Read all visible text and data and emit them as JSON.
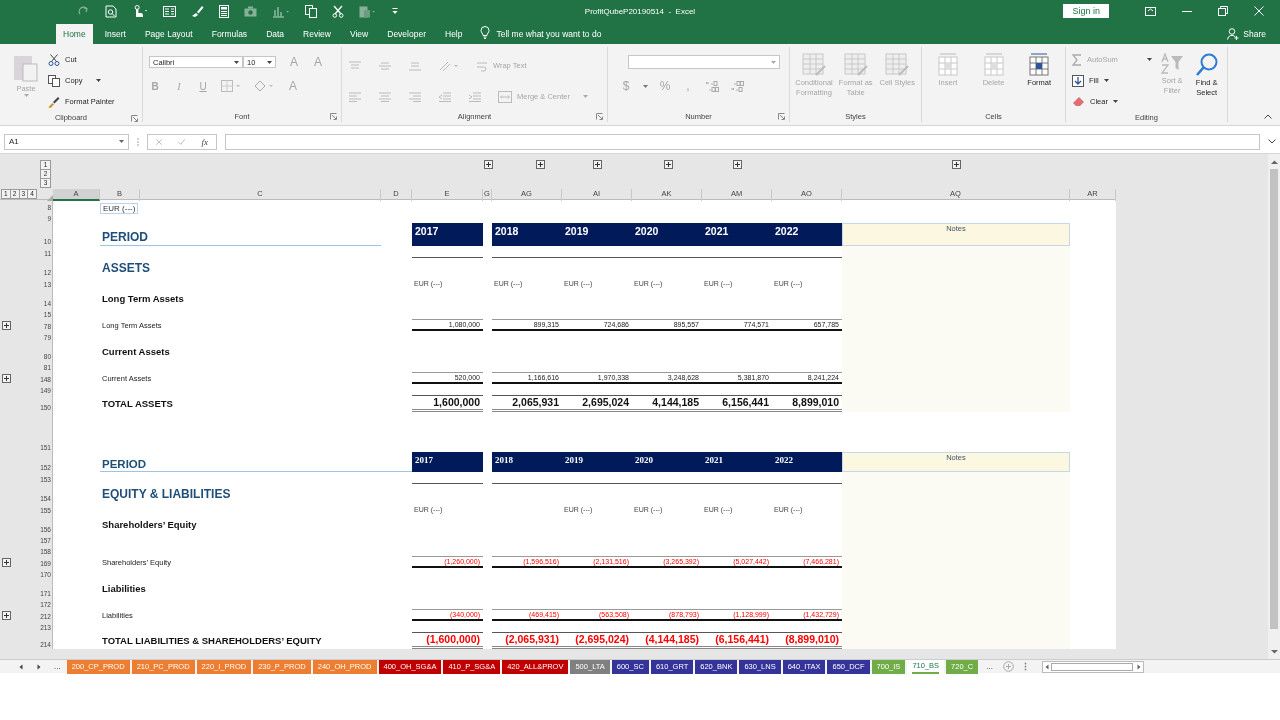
{
  "title_bar": {
    "title": "ProfitQubeP20190514  -  Excel",
    "sign_in": "Sign in"
  },
  "ribbon_tabs": [
    {
      "label": "Home",
      "selected": true
    },
    {
      "label": "Insert",
      "selected": false
    },
    {
      "label": "Page Layout",
      "selected": false
    },
    {
      "label": "Formulas",
      "selected": false
    },
    {
      "label": "Data",
      "selected": false
    },
    {
      "label": "Review",
      "selected": false
    },
    {
      "label": "View",
      "selected": false
    },
    {
      "label": "Developer",
      "selected": false
    },
    {
      "label": "Help",
      "selected": false
    }
  ],
  "tell_me": "Tell me what you want to do",
  "share": "Share",
  "ribbon": {
    "clipboard": {
      "label": "Clipboard",
      "paste": {
        "label": "Paste",
        "disabled": true
      },
      "cut": "Cut",
      "copy": "Copy",
      "format_painter": "Format Painter"
    },
    "font": {
      "label": "Font",
      "font_name": "Calibri",
      "font_size": "10",
      "grow": "A",
      "shrink": "A",
      "bold": "B",
      "italic": "I",
      "underline": "U",
      "font_color_button": "A"
    },
    "alignment": {
      "label": "Alignment",
      "wrap_text": {
        "label": "Wrap Text",
        "disabled": true
      },
      "merge": {
        "label": "Merge & Center",
        "disabled": true
      }
    },
    "number": {
      "label": "Number",
      "currency": "$",
      "percent": "%",
      "comma": ","
    },
    "styles": {
      "label": "Styles",
      "buttons": [
        {
          "label": "Conditional Formatting",
          "disabled": true
        },
        {
          "label": "Format as Table",
          "disabled": true
        },
        {
          "label": "Cell Styles",
          "disabled": true
        }
      ]
    },
    "cells": {
      "label": "Cells",
      "buttons": [
        {
          "label": "Insert",
          "disabled": true
        },
        {
          "label": "Delete",
          "disabled": true
        },
        {
          "label": "Format",
          "disabled": false
        }
      ]
    },
    "editing": {
      "label": "Editing",
      "autosum": {
        "label": "AutoSum",
        "disabled": true
      },
      "fill": {
        "label": "Fill",
        "disabled": false
      },
      "clear": {
        "label": "Clear",
        "disabled": false
      },
      "sort": {
        "label": "Sort & Filter",
        "disabled": true
      },
      "find": {
        "label": "Find & Select",
        "disabled": false
      }
    }
  },
  "formula_bar": {
    "name_box": "A1",
    "function_button": "fx"
  },
  "outline": {
    "column_levels": [
      "1",
      "2",
      "3"
    ],
    "row_levels": [
      "1",
      "2",
      "3",
      "4"
    ]
  },
  "columns": [
    {
      "label": "A",
      "selected": true
    },
    {
      "label": "B",
      "selected": false
    },
    {
      "label": "C",
      "selected": false
    },
    {
      "label": "D",
      "selected": false
    },
    {
      "label": "E",
      "selected": false
    },
    {
      "label": "G",
      "selected": false
    },
    {
      "label": "AG",
      "selected": false
    },
    {
      "label": "AI",
      "selected": false
    },
    {
      "label": "AK",
      "selected": false
    },
    {
      "label": "AM",
      "selected": false
    },
    {
      "label": "AO",
      "selected": false
    },
    {
      "label": "AQ",
      "selected": false
    },
    {
      "label": "AR",
      "selected": false
    }
  ],
  "rows": [
    {
      "number": "8",
      "kind": "unit_note",
      "label": "EUR (---)",
      "collapsed": false
    },
    {
      "number": "9",
      "kind": "blank",
      "collapsed": false
    },
    {
      "number": "10",
      "kind": "period",
      "compact": false,
      "label": "PERIOD",
      "first_year": "2017",
      "years": [
        "2018",
        "2019",
        "2020",
        "2021",
        "2022"
      ],
      "notes": "Notes",
      "collapsed": false
    },
    {
      "number": "11",
      "kind": "rule",
      "collapsed": false
    },
    {
      "number": "12",
      "kind": "heading",
      "label": "ASSETS",
      "collapsed": false
    },
    {
      "number": "13",
      "kind": "units",
      "first_unit": "EUR (---)",
      "first_column_empty": false,
      "units": [
        "EUR (---)",
        "EUR (---)",
        "EUR (---)",
        "EUR (---)",
        "EUR (---)"
      ],
      "collapsed": false
    },
    {
      "number": "14",
      "kind": "subheading",
      "label": "Long Term Assets",
      "collapsed": false
    },
    {
      "number": "15",
      "kind": "blank",
      "collapsed": false
    },
    {
      "number": "78",
      "kind": "line",
      "label": "Long Term Assets",
      "first_value": "1,080,000",
      "values": [
        "899,315",
        "724,686",
        "895,557",
        "774,571",
        "657,785"
      ],
      "negative": false,
      "collapsed": true
    },
    {
      "number": "79",
      "kind": "blank",
      "collapsed": false
    },
    {
      "number": "80",
      "kind": "subheading",
      "label": "Current Assets",
      "collapsed": false
    },
    {
      "number": "81",
      "kind": "blank",
      "collapsed": false
    },
    {
      "number": "148",
      "kind": "line",
      "label": "Current Assets",
      "first_value": "520,000",
      "values": [
        "1,166,616",
        "1,970,338",
        "3,248,628",
        "5,381,870",
        "8,241,224"
      ],
      "negative": false,
      "collapsed": true
    },
    {
      "number": "149",
      "kind": "blank",
      "collapsed": false
    },
    {
      "number": "150",
      "kind": "total",
      "label": "TOTAL ASSETS",
      "first_value": "1,600,000",
      "values": [
        "2,065,931",
        "2,695,024",
        "4,144,185",
        "6,156,441",
        "8,899,010"
      ],
      "negative": false,
      "collapsed": false
    },
    {
      "number": "151",
      "kind": "gap",
      "collapsed": false
    },
    {
      "number": "152",
      "kind": "period",
      "compact": true,
      "label": "PERIOD",
      "first_year": "2017",
      "years": [
        "2018",
        "2019",
        "2020",
        "2021",
        "2022"
      ],
      "notes": "Notes",
      "collapsed": false
    },
    {
      "number": "153",
      "kind": "rule",
      "collapsed": false
    },
    {
      "number": "154",
      "kind": "heading",
      "label": "EQUITY & LIABILITIES",
      "collapsed": false
    },
    {
      "number": "155",
      "kind": "units",
      "first_unit": "EUR (---)",
      "first_column_empty": true,
      "units": [
        "EUR (---)",
        "EUR (---)",
        "EUR (---)",
        "EUR (---)"
      ],
      "collapsed": false
    },
    {
      "number": "156",
      "kind": "subheading",
      "label": "Shareholders’ Equity",
      "collapsed": false
    },
    {
      "number": "157",
      "kind": "blank",
      "collapsed": false
    },
    {
      "number": "158",
      "kind": "blank",
      "collapsed": false
    },
    {
      "number": "169",
      "kind": "line",
      "label": "Shareholders’ Equity",
      "first_value": "(1,260,000)",
      "values": [
        "(1,596,516)",
        "(2,131,516)",
        "(3,265,392)",
        "(5,027,442)",
        "(7,466,281)"
      ],
      "negative": true,
      "collapsed": true
    },
    {
      "number": "170",
      "kind": "blank",
      "collapsed": false
    },
    {
      "number": "171",
      "kind": "subheading",
      "label": "Liabilities",
      "collapsed": false
    },
    {
      "number": "172",
      "kind": "blank",
      "collapsed": false
    },
    {
      "number": "212",
      "kind": "line",
      "label": "Liabilities",
      "first_value": "(340,000)",
      "values": [
        "(469,415)",
        "(563,508)",
        "(878,793)",
        "(1,128,999)",
        "(1,432,729)"
      ],
      "negative": true,
      "collapsed": true
    },
    {
      "number": "213",
      "kind": "blank",
      "collapsed": false
    },
    {
      "number": "214",
      "kind": "total",
      "label": "TOTAL LIABILITIES & SHAREHOLDERS’ EQUITY",
      "first_value": "(1,600,000)",
      "values": [
        "(2,065,931)",
        "(2,695,024)",
        "(4,144,185)",
        "(6,156,441)",
        "(8,899,010)"
      ],
      "negative": true,
      "collapsed": false
    }
  ],
  "sheet_nav": {
    "more_left": "...",
    "more_right": "..."
  },
  "sheet_tabs": [
    {
      "label": "200_CP_PROD",
      "color": "#ed7d31",
      "selected": false
    },
    {
      "label": "210_PC_PROD",
      "color": "#ed7d31",
      "selected": false
    },
    {
      "label": "220_I_PROD",
      "color": "#ed7d31",
      "selected": false
    },
    {
      "label": "230_P_PROD",
      "color": "#ed7d31",
      "selected": false
    },
    {
      "label": "240_OH_PROD",
      "color": "#ed7d31",
      "selected": false
    },
    {
      "label": "400_OH_SG&A",
      "color": "#c00000",
      "selected": false
    },
    {
      "label": "410_P_SG&A",
      "color": "#c00000",
      "selected": false
    },
    {
      "label": "420_ALL&PROV",
      "color": "#c00000",
      "selected": false
    },
    {
      "label": "500_LTA",
      "color": "#808080",
      "selected": false
    },
    {
      "label": "600_SC",
      "color": "#333399",
      "selected": false
    },
    {
      "label": "610_GRT",
      "color": "#333399",
      "selected": false
    },
    {
      "label": "620_BNK",
      "color": "#333399",
      "selected": false
    },
    {
      "label": "630_LNS",
      "color": "#333399",
      "selected": false
    },
    {
      "label": "640_ITAX",
      "color": "#333399",
      "selected": false
    },
    {
      "label": "650_DCF",
      "color": "#333399",
      "selected": false
    },
    {
      "label": "700_IS",
      "color": "#70ad47",
      "selected": false
    },
    {
      "label": "710_BS",
      "color": "#70ad47",
      "selected": true
    },
    {
      "label": "720_C",
      "color": "#70ad47",
      "selected": false
    }
  ]
}
